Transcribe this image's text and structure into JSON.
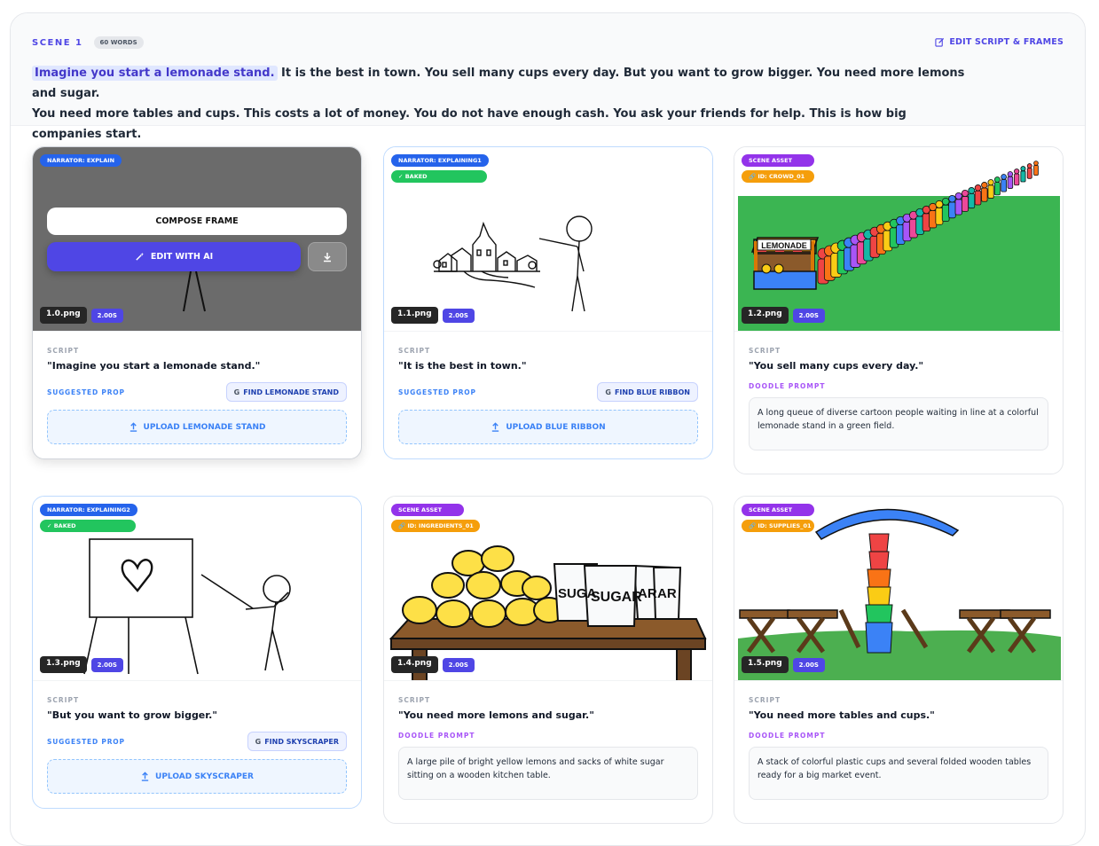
{
  "scene": {
    "label": "SCENE 1",
    "words": "60 WORDS",
    "edit_label": "EDIT SCRIPT & FRAMES",
    "highlight": "Imagine you start a lemonade stand.",
    "text_line1": " It is the best in town. You sell many cups every day. But you want to grow bigger. You need more lemons and sugar.",
    "text_line2": "You need more tables and cups. This costs a lot of money. You do not have enough cash. You ask your friends for help. This is how big companies start."
  },
  "labels": {
    "script": "SCRIPT",
    "suggested_prop": "SUGGESTED PROP",
    "doodle_prompt": "DOODLE PROMPT",
    "baked": "BAKED",
    "scene_asset": "SCENE ASSET"
  },
  "overlay": {
    "compose": "COMPOSE FRAME",
    "edit_ai": "EDIT WITH AI"
  },
  "cards": [
    {
      "tag": "NARRATOR: EXPLAIN",
      "file": "1.0.png",
      "duration": "2.00S",
      "quote": "\"Imagine you start a lemonade stand.\"",
      "find": "FIND LEMONADE STAND",
      "upload": "UPLOAD LEMONADE STAND"
    },
    {
      "tag": "NARRATOR: EXPLAINING1",
      "file": "1.1.png",
      "duration": "2.00S",
      "quote": "\"It is the best in town.\"",
      "find": "FIND BLUE RIBBON",
      "upload": "UPLOAD BLUE RIBBON"
    },
    {
      "id": "ID: CROWD_01",
      "sign": "LEMONADE",
      "file": "1.2.png",
      "duration": "2.00S",
      "quote": "\"You sell many cups every day.\"",
      "prompt": "A long queue of diverse cartoon people waiting in line at a colorful lemonade stand in a green field."
    },
    {
      "tag": "NARRATOR: EXPLAINING2",
      "file": "1.3.png",
      "duration": "2.00S",
      "quote": "\"But you want to grow bigger.\"",
      "find": "FIND SKYSCRAPER",
      "upload": "UPLOAD SKYSCRAPER"
    },
    {
      "id": "ID: INGREDIENTS_01",
      "sack1": "SUGA",
      "sack2": "SUGAR",
      "sack3": "AR",
      "sack4": "AR",
      "file": "1.4.png",
      "duration": "2.00S",
      "quote": "\"You need more lemons and sugar.\"",
      "prompt": "A large pile of bright yellow lemons and sacks of white sugar sitting on a wooden kitchen table."
    },
    {
      "id": "ID: SUPPLIES_01",
      "file": "1.5.png",
      "duration": "2.00S",
      "quote": "\"You need more tables and cups.\"",
      "prompt": "A stack of colorful plastic cups and several folded wooden tables ready for a big market event."
    }
  ]
}
